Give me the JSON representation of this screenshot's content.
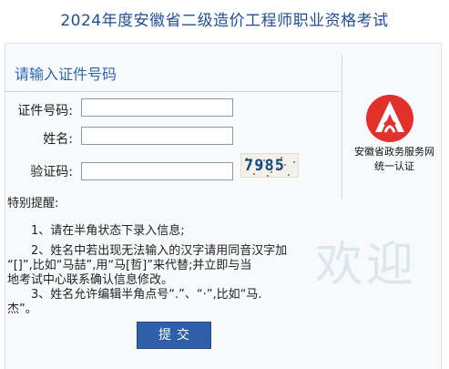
{
  "page": {
    "title": "2024年度安徽省二级造价工程师职业资格考试"
  },
  "form": {
    "heading": "请输入证件号码",
    "id_label": "证件号码:",
    "id_value": "",
    "name_label": "姓名:",
    "name_value": "",
    "captcha_label": "验证码:",
    "captcha_value": "",
    "captcha_image_text": "7985",
    "submit_label": "提交"
  },
  "auth": {
    "line1": "安徽省政务服务网",
    "line2": "统一认证",
    "logo_icon": "anhui-gov-service-logo-icon",
    "logo_color": "#e2312b"
  },
  "notes": {
    "title": "特别提醒:",
    "item1": "1、请在半角状态下录入信息;",
    "item2_line1": "2、姓名中若出现无法输入的汉字请用同音汉字加",
    "item2_line2": "“[]”,比如“马喆”,用“马[哲]”来代替;并立即与当",
    "item2_line3": "地考试中心联系确认信息修改。",
    "item3_line1": "3、姓名允许编辑半角点号“.”、“·”,比如“马.",
    "item3_line2": "杰”。"
  },
  "watermark": "欢迎",
  "colors": {
    "title": "#1f4e96",
    "heading": "#2a66b4",
    "button": "#2e5fa8"
  }
}
